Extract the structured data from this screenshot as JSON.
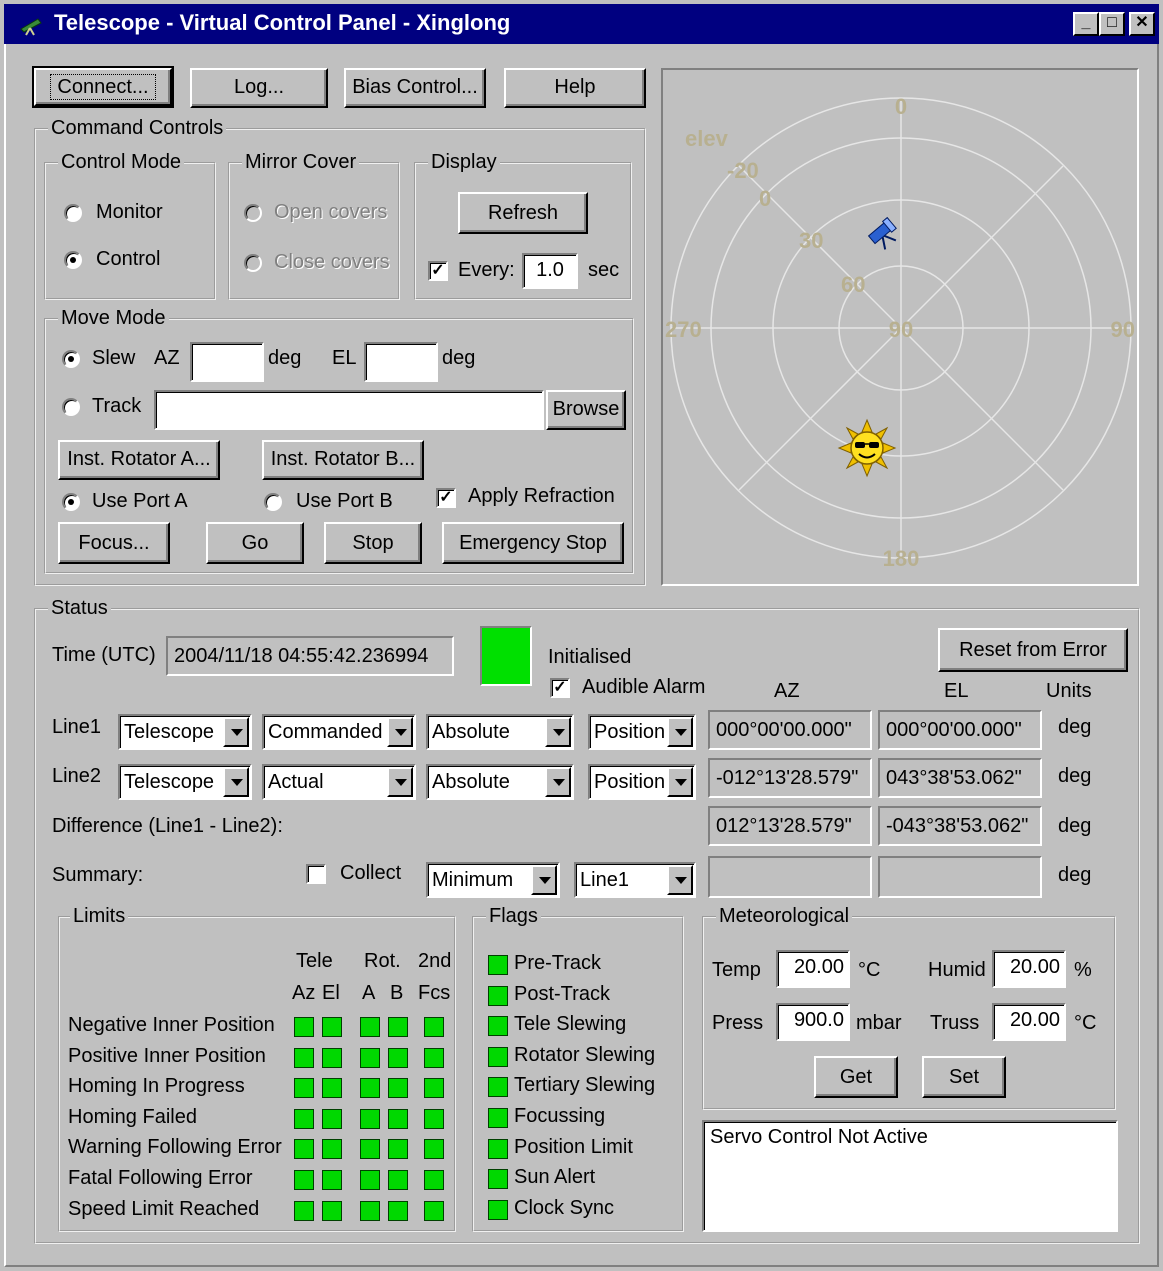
{
  "window": {
    "title": "Telescope - Virtual Control Panel - Xinglong",
    "minimize": "_",
    "maximize": "□",
    "close": "✕"
  },
  "toolbar": {
    "connect": "Connect...",
    "log": "Log...",
    "bias": "Bias Control...",
    "help": "Help"
  },
  "command": {
    "group": "Command Controls",
    "control_mode": {
      "group": "Control Mode",
      "monitor": "Monitor",
      "control": "Control",
      "selected": "Control"
    },
    "mirror_cover": {
      "group": "Mirror Cover",
      "open": "Open covers",
      "close": "Close covers"
    },
    "display": {
      "group": "Display",
      "refresh": "Refresh",
      "every_label": "Every:",
      "every_value": "1.0",
      "unit": "sec",
      "every_checked": true
    }
  },
  "move": {
    "group": "Move Mode",
    "slew": "Slew",
    "az": "AZ",
    "az_value": "",
    "deg1": "deg",
    "el": "EL",
    "el_value": "",
    "deg2": "deg",
    "track": "Track",
    "track_value": "",
    "browse": "Browse",
    "rot_a": "Inst. Rotator A...",
    "rot_b": "Inst. Rotator B...",
    "port_a": "Use Port A",
    "port_b": "Use Port B",
    "refraction": "Apply Refraction",
    "focus": "Focus...",
    "go": "Go",
    "stop": "Stop",
    "emergency": "Emergency Stop"
  },
  "sky": {
    "elev": "elev",
    "n0": "0",
    "el_m20": "-20",
    "el_0": "0",
    "el_30": "30",
    "el_60": "60",
    "el_90": "90",
    "w270": "270",
    "e90": "90",
    "s180": "180"
  },
  "status": {
    "group": "Status",
    "time_label": "Time (UTC)",
    "time_value": "2004/11/18 04:55:42.236994",
    "initialised": "Initialised",
    "alarm": "Audible Alarm",
    "reset": "Reset from Error",
    "h_az": "AZ",
    "h_el": "EL",
    "h_units": "Units",
    "line1": {
      "label": "Line1",
      "src": "Telescope",
      "mode": "Commanded",
      "ref": "Absolute",
      "kind": "Position",
      "az": "000°00'00.000\"",
      "el": "000°00'00.000\"",
      "unit": "deg"
    },
    "line2": {
      "label": "Line2",
      "src": "Telescope",
      "mode": "Actual",
      "ref": "Absolute",
      "kind": "Position",
      "az": "-012°13'28.579\"",
      "el": "043°38'53.062\"",
      "unit": "deg"
    },
    "diff": {
      "label": "Difference (Line1 - Line2):",
      "az": "012°13'28.579\"",
      "el": "-043°38'53.062\"",
      "unit": "deg"
    },
    "summary": {
      "label": "Summary:",
      "collect": "Collect",
      "stat": "Minimum",
      "line": "Line1",
      "az": "",
      "el": "",
      "unit": "deg"
    }
  },
  "limits": {
    "group": "Limits",
    "h_tele": "Tele",
    "h_rot": "Rot.",
    "h_2nd": "2nd",
    "h_az": "Az",
    "h_el": "El",
    "h_a": "A",
    "h_b": "B",
    "h_fcs": "Fcs",
    "rows": [
      "Negative Inner Position",
      "Positive Inner Position",
      "Homing In Progress",
      "Homing Failed",
      "Warning Following Error",
      "Fatal Following Error",
      "Speed Limit Reached"
    ]
  },
  "flags": {
    "group": "Flags",
    "items": [
      "Pre-Track",
      "Post-Track",
      "Tele Slewing",
      "Rotator Slewing",
      "Tertiary Slewing",
      "Focussing",
      "Position Limit",
      "Sun Alert",
      "Clock Sync"
    ]
  },
  "meteo": {
    "group": "Meteorological",
    "temp": "Temp",
    "temp_value": "20.00",
    "temp_unit": "°C",
    "humid": "Humid",
    "humid_value": "20.00",
    "humid_unit": "%",
    "press": "Press",
    "press_value": "900.0",
    "press_unit": "mbar",
    "truss": "Truss",
    "truss_value": "20.00",
    "truss_unit": "°C",
    "get": "Get",
    "set": "Set"
  },
  "message": "Servo Control Not Active"
}
